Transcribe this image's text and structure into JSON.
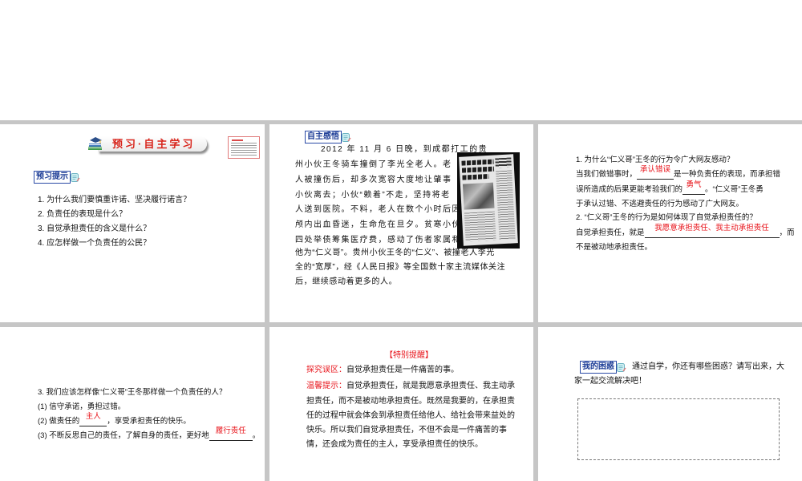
{
  "colors": {
    "answer_red": "#e8141b",
    "label_blue": "#1c3c96",
    "sorter_gray": "#c6c6c6"
  },
  "icons": {
    "label_icon": "notepad-icon",
    "banner_icon": "books-cap-icon",
    "clipping_image": "newspaper-clipping"
  },
  "slides": {
    "s1": {
      "banner_title": "预习·自主学习",
      "section_label": "预习提示",
      "questions": [
        "1. 为什么我们要慎重许诺、坚决履行诺言？",
        "2. 负责任的表现是什么？",
        "3. 自觉承担责任的含义是什么？",
        "4. 应怎样做一个负责任的公民？"
      ]
    },
    "s2": {
      "section_label": "自主感悟",
      "paragraph_lines": [
        "2012 年 11 月 6 日晚，到成都打工的贵",
        "州小伙王冬骑车撞倒了李光全老人。老",
        "人被撞伤后，却多次宽容大度地让肇事",
        "小伙离去；小伙“赖着”不走，坚持将老",
        "人送到医院。不料，老人在数个小时后因",
        "颅内出血昏迷，生命危在旦夕。贫寒小伙",
        "四处举债筹集医疗费，感动了伤者家属和",
        "他为“仁义哥”。贵州小伙王冬的“仁义”、被撞老人李光",
        "全的“宽厚”，经《人民日报》等全国数十家主流媒体关注",
        "后，继续感动着更多的人。"
      ]
    },
    "s3": {
      "lines": [
        {
          "text": "1. 为什么“仁义哥”王冬的行为令广大网友感动？"
        },
        {
          "pre": "当我们做错事时，",
          "answer": "承认错误",
          "post": "是一种负责任的表现，而承担错"
        },
        {
          "pre": "误所造成的后果更能考验我们的",
          "answer": "勇气",
          "post": "。“仁义哥”王冬勇"
        },
        {
          "text": "于承认过错、不逃避责任的行为感动了广大网友。"
        },
        {
          "text": "2. “仁义哥”王冬的行为是如何体现了自觉承担责任的？"
        },
        {
          "pre": "自觉承担责任，就是",
          "answer": "我愿意承担责任、我主动承担责任",
          "post": "，而"
        },
        {
          "text": "不是被动地承担责任。"
        }
      ]
    },
    "s4": {
      "lines": [
        {
          "text": "3. 我们应该怎样像“仁义哥”王冬那样做一个负责任的人？"
        },
        {
          "text": "(1) 信守承诺，勇担过错。"
        },
        {
          "pre": "(2) 做责任的",
          "answer": "主人",
          "post": "，享受承担责任的快乐。"
        },
        {
          "pre": "(3) 不断反思自己的责任，了解自身的责任，更好地",
          "answer": "履行责任",
          "post": "。"
        }
      ]
    },
    "s5": {
      "title": "【特别提醒】",
      "misconception_label": "探究误区：",
      "misconception_text": "自觉承担责任是一件痛苦的事。",
      "tip_label": "温馨提示：",
      "tip_lines": [
        "自觉承担责任，就是我愿意承担责任、我主动承",
        "担责任，而不是被动地承担责任。既然是我要的，在承担责",
        "任的过程中就会体会到承担责任给他人、给社会带来益处的",
        "快乐。所以我们自觉承担责任，不但不会是一件痛苦的事",
        "情，还会成为责任的主人，享受承担责任的快乐。"
      ]
    },
    "s6": {
      "section_label": "我的困惑",
      "prompt_lines": [
        "通过自学，你还有哪些困惑？请写出来，大",
        "家一起交流解决吧！"
      ]
    }
  }
}
